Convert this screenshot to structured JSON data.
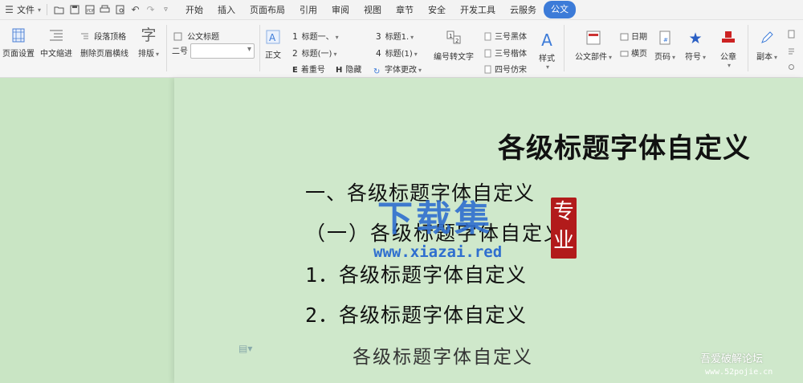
{
  "menubar": {
    "file_label": "文件",
    "tabs": [
      "开始",
      "插入",
      "页面布局",
      "引用",
      "审阅",
      "视图",
      "章节",
      "安全",
      "开发工具",
      "云服务",
      "公文"
    ],
    "active_tab": "公文"
  },
  "ribbon": {
    "page_setup": "页面设置",
    "cn_indent": "中文缩进",
    "para_top": "段落顶格",
    "del_header_line": "删除页眉横线",
    "layout": "排版",
    "layout_icon_char": "字",
    "gw_title_label": "公文标题",
    "size_label": "二号",
    "zhengwen": "正文",
    "heading1": "标题一、",
    "heading2": "标题(一)",
    "heading3": "标题1.",
    "heading4": "标题(1)",
    "heading_nums": [
      "1",
      "2",
      "3",
      "4"
    ],
    "zhehao": "着重号",
    "zhehao_mark": "E",
    "yincang": "隐藏",
    "yincang_mark": "H",
    "font_change": "字体更改",
    "num_to_text": "编号转文字",
    "san_hei": "三号黑体",
    "san_kai": "三号楷体",
    "si_fang": "四号仿宋",
    "style": "样式",
    "gw_parts": "公文部件",
    "date": "日期",
    "landscape": "横页",
    "page_num": "页码",
    "symbol": "符号",
    "seal": "公章",
    "copy": "副本"
  },
  "document": {
    "title": "各级标题字体自定义",
    "h1": "一、各级标题字体自定义",
    "h2": "（一）各级标题字体自定义",
    "h3": "1．各级标题字体自定义",
    "h4": "2．各级标题字体自定义",
    "body": "各级标题字体自定义"
  },
  "watermark": {
    "main": "下载集",
    "seal_chars": [
      "专",
      "业"
    ],
    "url": "www.xiazai.red",
    "corner_text": "吾爱破解论坛",
    "corner_url": "www.52pojie.cn"
  },
  "colors": {
    "accent": "#3c7bd8",
    "page_bg": "#cfe8cb",
    "seal_red": "#b21b1b"
  }
}
